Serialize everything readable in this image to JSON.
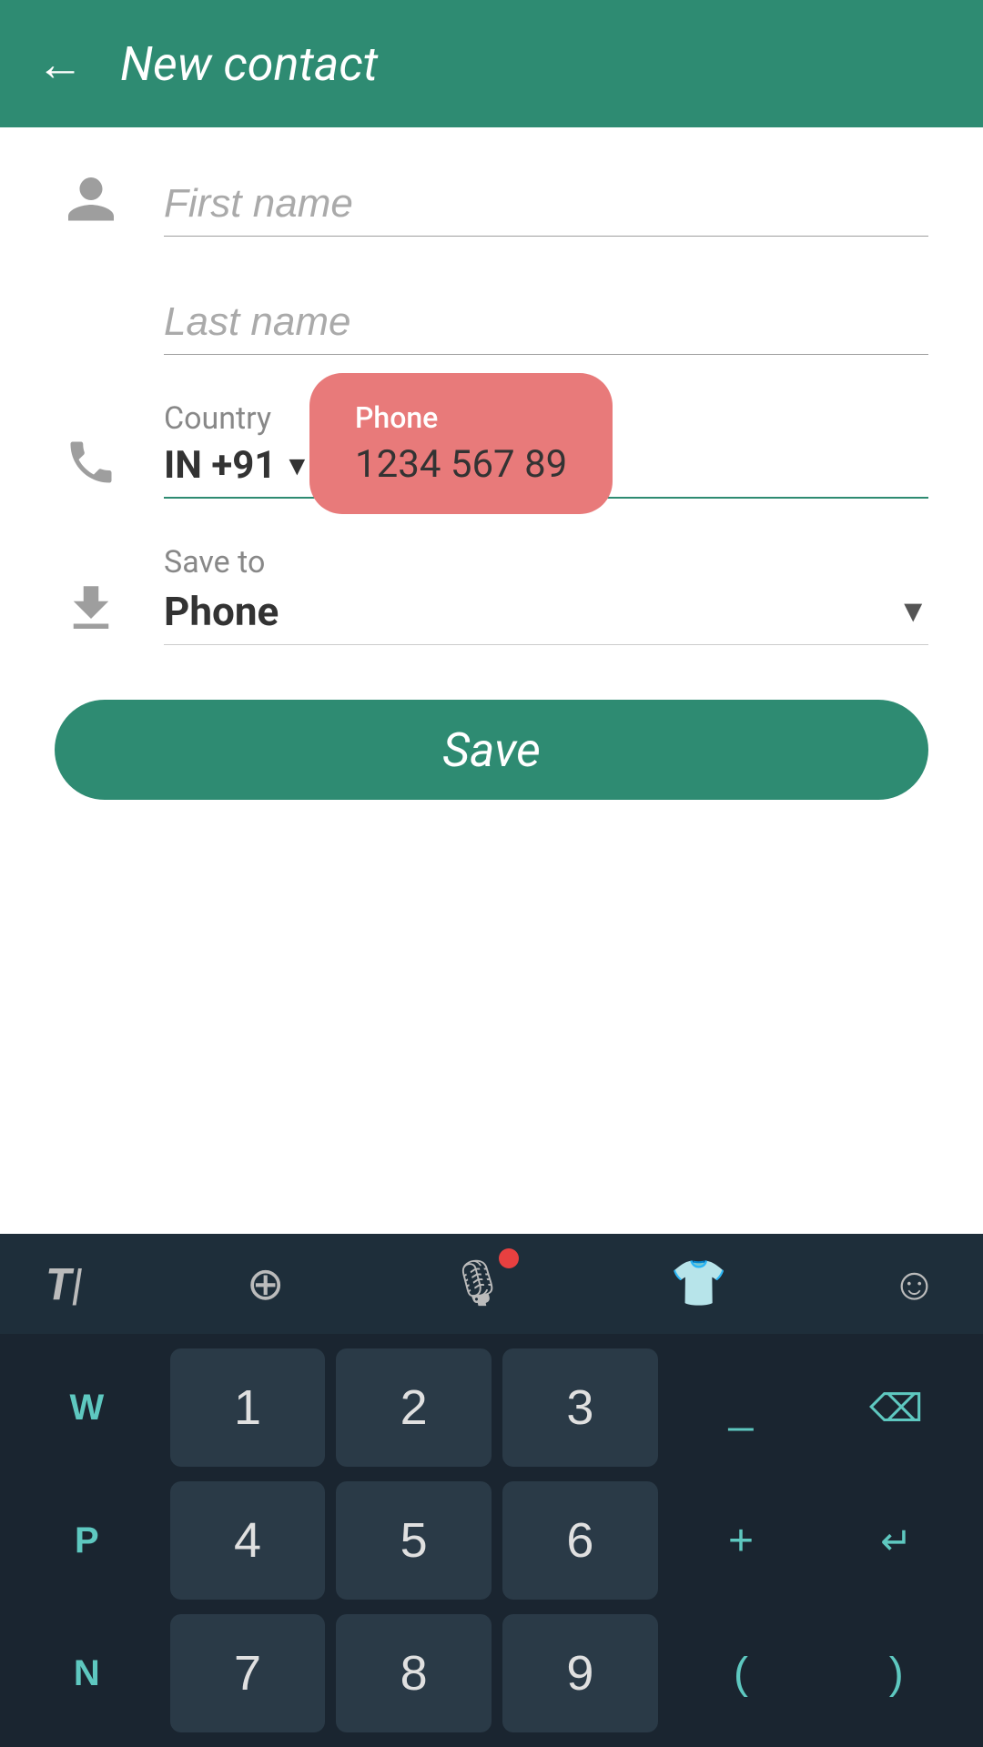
{
  "header": {
    "title": "New contact",
    "back_label": "←"
  },
  "form": {
    "first_name_placeholder": "First name",
    "last_name_placeholder": "Last name",
    "country_label": "Country",
    "phone_label": "Phone",
    "country_code": "IN +91",
    "phone_number": "1234 567 89",
    "tooltip_label": "Phone",
    "tooltip_value": "1234 567 89",
    "save_to_label": "Save to",
    "save_to_value": "Phone",
    "save_button_label": "Save"
  },
  "keyboard": {
    "row1": [
      "1",
      "2",
      "3"
    ],
    "row2": [
      "4",
      "5",
      "6"
    ],
    "row3": [
      "7",
      "8",
      "9"
    ],
    "symbol_row1_left": "_",
    "symbol_row1_right": "⌫",
    "symbol_row2_left": "+",
    "symbol_row2_right": "↵",
    "letter_col1": [
      "W",
      "P",
      "N"
    ],
    "toolbar": {
      "font_icon": "T|",
      "globe_icon": "⊕",
      "mic_icon": "🎤",
      "shirt_icon": "👕",
      "emoji_icon": "☺"
    }
  },
  "colors": {
    "primary": "#2e8b72",
    "tooltip_bg": "#e87a7a",
    "header_bg": "#2e8b72",
    "keyboard_bg": "#1a2530"
  }
}
